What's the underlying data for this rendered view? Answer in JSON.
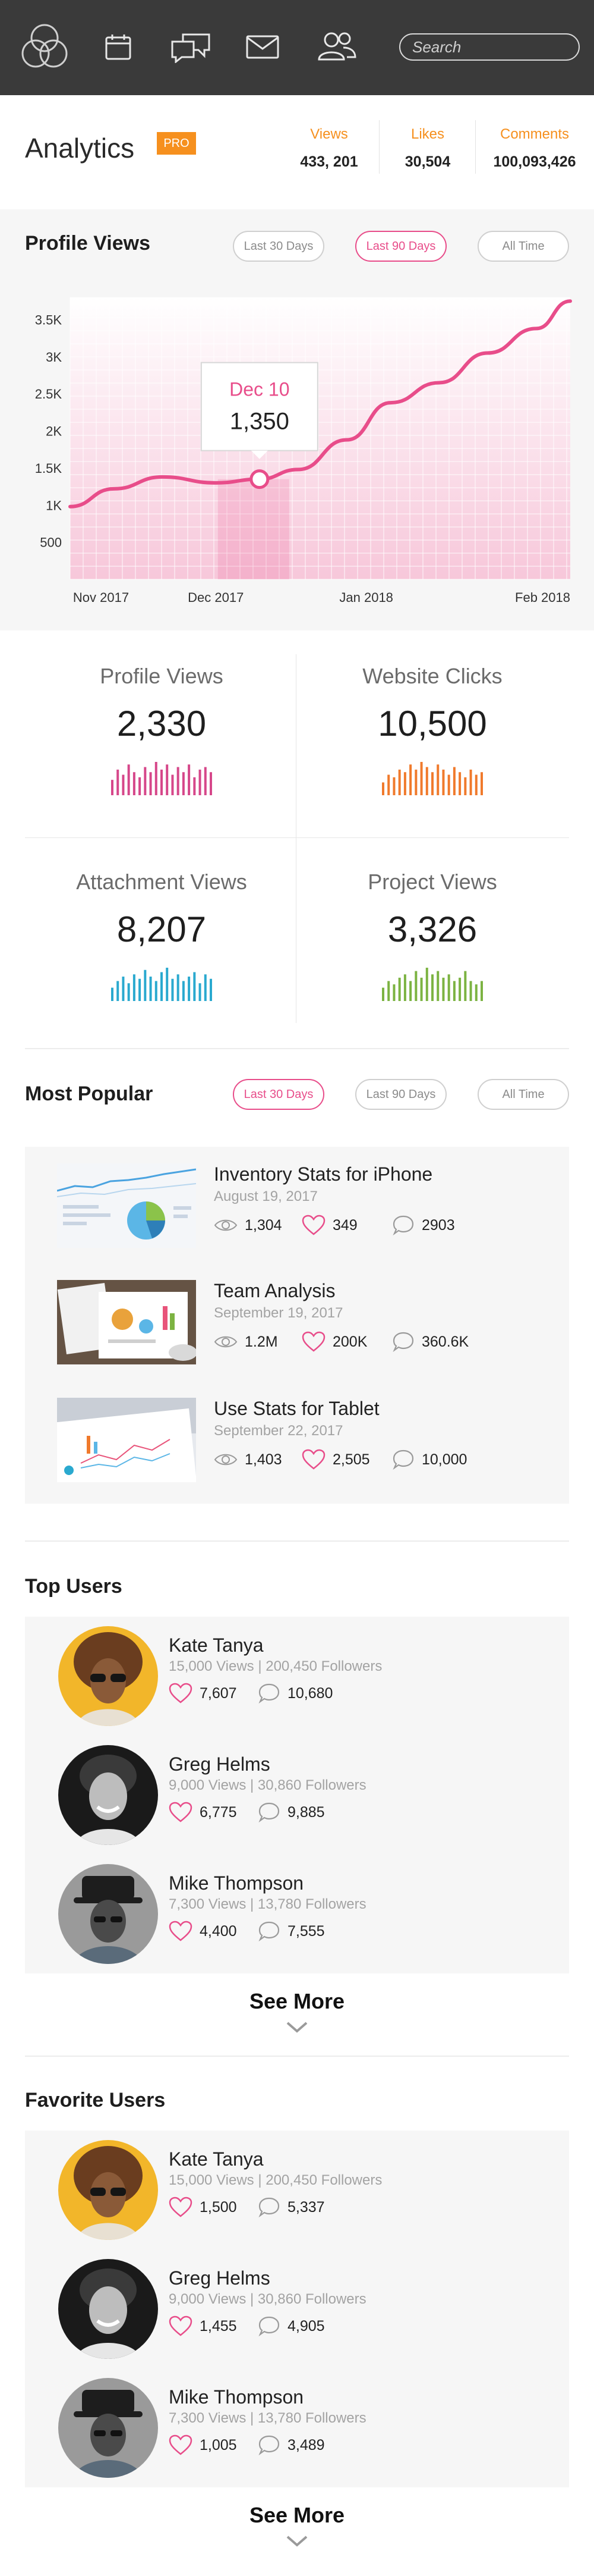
{
  "nav": {
    "search_placeholder": "Search",
    "icons": [
      "logo-rings-icon",
      "calendar-icon",
      "chat-icon",
      "mail-icon",
      "users-icon"
    ]
  },
  "header": {
    "title": "Analytics",
    "badge": "PRO",
    "stats": [
      {
        "label": "Views",
        "value": "433, 201"
      },
      {
        "label": "Likes",
        "value": "30,504"
      },
      {
        "label": "Comments",
        "value": "100,093,426"
      }
    ]
  },
  "profile_views": {
    "title": "Profile Views",
    "filters": [
      {
        "label": "Last 30 Days",
        "active": false
      },
      {
        "label": "Last 90 Days",
        "active": true
      },
      {
        "label": "All Time",
        "active": false
      }
    ],
    "tooltip_date": "Dec 10",
    "tooltip_value": "1,350",
    "accent": "#e84d8a"
  },
  "chart_data": {
    "type": "line",
    "x_labels": [
      "Nov 2017",
      "Dec 2017",
      "Jan 2018",
      "Feb 2018"
    ],
    "y_ticks": [
      "500",
      "1K",
      "1.5K",
      "2K",
      "2.5K",
      "3K",
      "3.5K"
    ],
    "ylim": [
      0,
      3800
    ],
    "grid": true,
    "series": [
      {
        "values": [
          {
            "x": "2017-11-01",
            "y": 980
          },
          {
            "x": "2017-11-10",
            "y": 1220
          },
          {
            "x": "2017-11-20",
            "y": 1380
          },
          {
            "x": "2017-12-01",
            "y": 1300
          },
          {
            "x": "2017-12-10",
            "y": 1350
          },
          {
            "x": "2017-12-18",
            "y": 1480
          },
          {
            "x": "2017-12-28",
            "y": 1880
          },
          {
            "x": "2018-01-06",
            "y": 2380
          },
          {
            "x": "2018-01-16",
            "y": 2650
          },
          {
            "x": "2018-01-26",
            "y": 3050
          },
          {
            "x": "2018-02-05",
            "y": 3380
          },
          {
            "x": "2018-02-12",
            "y": 3750
          }
        ]
      }
    ],
    "highlight": {
      "x": "2017-12-10",
      "y": 1350
    }
  },
  "stat_cards": [
    {
      "label": "Profile Views",
      "value": "2,330",
      "color": "#d6478a",
      "bars": [
        6,
        10,
        8,
        12,
        9,
        7,
        11,
        9,
        13,
        10,
        12,
        8,
        11,
        9,
        12,
        7,
        10,
        11,
        9
      ]
    },
    {
      "label": "Website Clicks",
      "value": "10,500",
      "color": "#f07a2c",
      "bars": [
        5,
        8,
        7,
        10,
        9,
        12,
        10,
        13,
        11,
        9,
        12,
        10,
        8,
        11,
        9,
        7,
        10,
        8,
        9
      ]
    },
    {
      "label": "Attachment Views",
      "value": "8,207",
      "color": "#2aa9cf",
      "bars": [
        6,
        9,
        11,
        8,
        12,
        10,
        14,
        11,
        9,
        13,
        15,
        10,
        12,
        9,
        11,
        13,
        8,
        12,
        10
      ]
    },
    {
      "label": "Project Views",
      "value": "3,326",
      "color": "#7cb342",
      "bars": [
        4,
        6,
        5,
        7,
        8,
        6,
        9,
        7,
        10,
        8,
        9,
        7,
        8,
        6,
        7,
        9,
        6,
        5,
        6
      ]
    }
  ],
  "most_popular": {
    "title": "Most Popular",
    "filters": [
      {
        "label": "Last 30 Days",
        "active": true
      },
      {
        "label": "Last 90 Days",
        "active": false
      },
      {
        "label": "All Time",
        "active": false
      }
    ],
    "items": [
      {
        "title": "Inventory Stats for iPhone",
        "date": "August 19, 2017",
        "views": "1,304",
        "likes": "349",
        "comments": "2903"
      },
      {
        "title": "Team Analysis",
        "date": "September 19, 2017",
        "views": "1.2M",
        "likes": "200K",
        "comments": "360.6K"
      },
      {
        "title": "Use Stats for Tablet",
        "date": "September 22, 2017",
        "views": "1,403",
        "likes": "2,505",
        "comments": "10,000"
      }
    ]
  },
  "top_users": {
    "title": "Top Users",
    "users": [
      {
        "name": "Kate Tanya",
        "meta": "15,000 Views  |  200,450 Followers",
        "likes": "7,607",
        "comments": "10,680"
      },
      {
        "name": "Greg Helms",
        "meta": "9,000 Views  |  30,860 Followers",
        "likes": "6,775",
        "comments": "9,885"
      },
      {
        "name": "Mike Thompson",
        "meta": "7,300 Views  |  13,780 Followers",
        "likes": "4,400",
        "comments": "7,555"
      }
    ],
    "see_more": "See More"
  },
  "favorite_users": {
    "title": "Favorite Users",
    "users": [
      {
        "name": "Kate Tanya",
        "meta": "15,000 Views  |  200,450 Followers",
        "likes": "1,500",
        "comments": "5,337"
      },
      {
        "name": "Greg Helms",
        "meta": "9,000 Views  |  30,860 Followers",
        "likes": "1,455",
        "comments": "4,905"
      },
      {
        "name": "Mike Thompson",
        "meta": "7,300 Views  |  13,780 Followers",
        "likes": "1,005",
        "comments": "3,489"
      }
    ],
    "see_more": "See More"
  }
}
